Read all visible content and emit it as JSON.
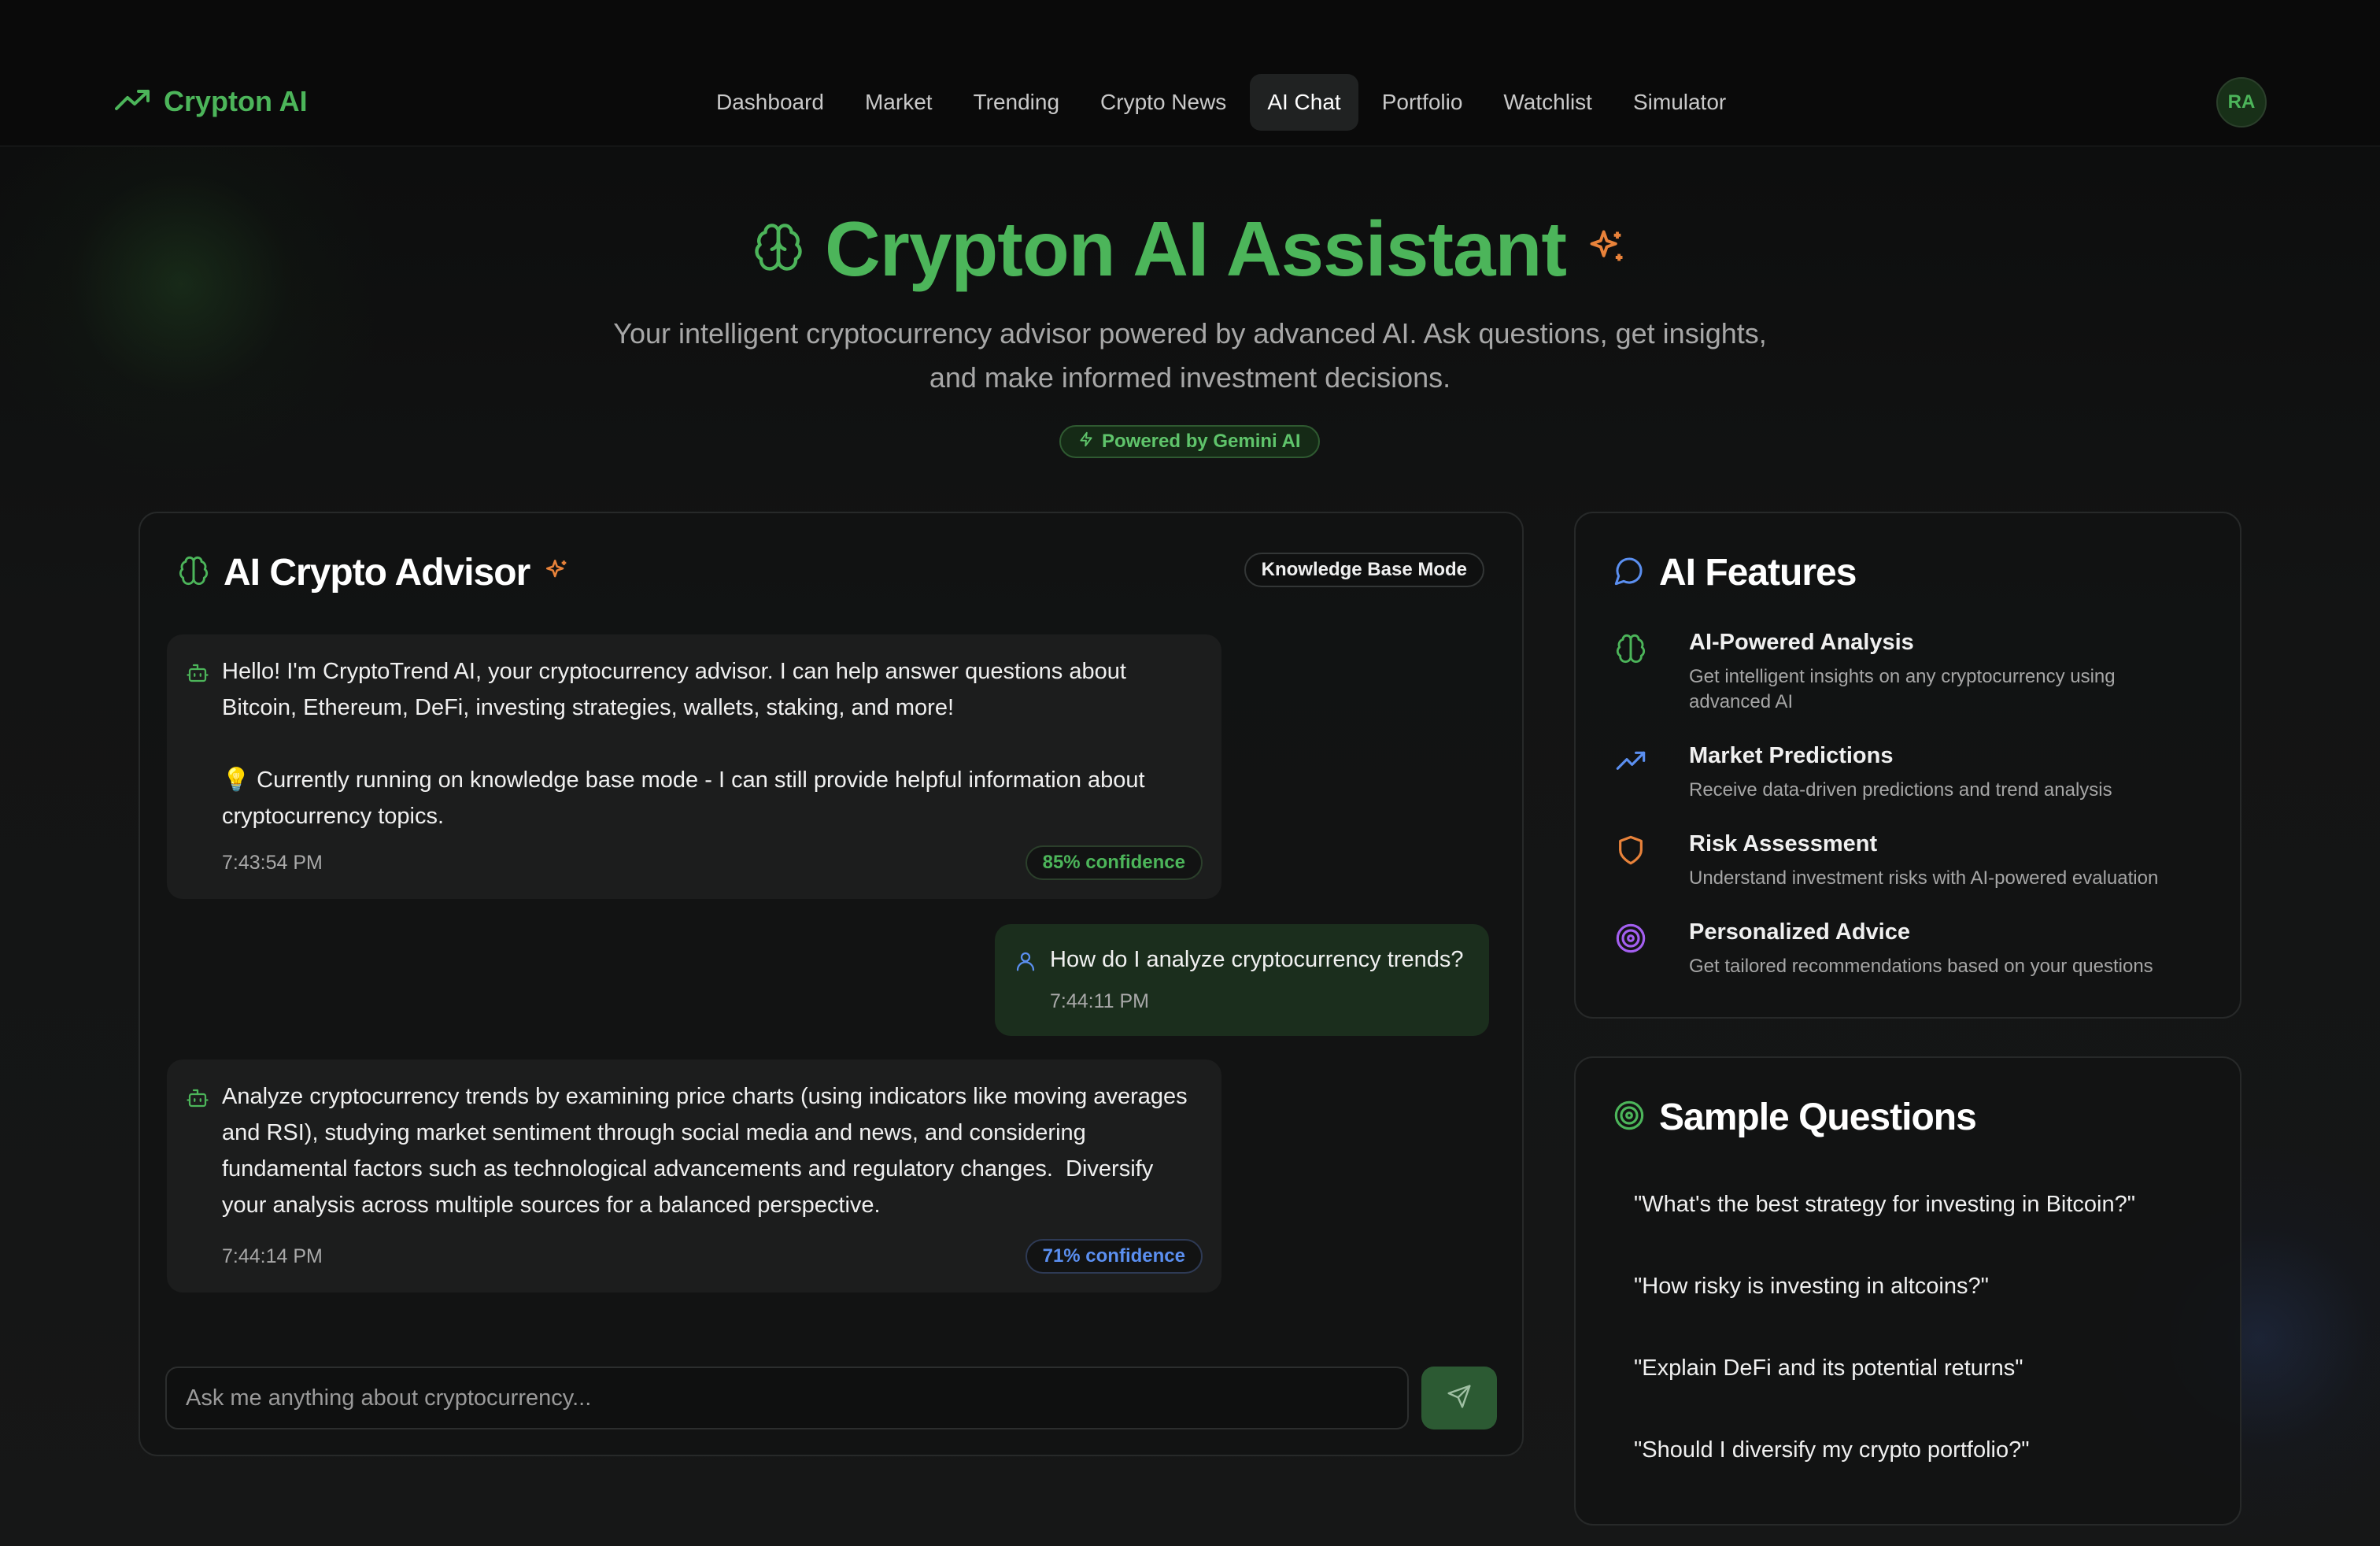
{
  "nav": {
    "brand": "Crypton AI",
    "items": [
      "Dashboard",
      "Market",
      "Trending",
      "Crypto News",
      "AI Chat",
      "Portfolio",
      "Watchlist",
      "Simulator"
    ],
    "active": "AI Chat",
    "avatar": "RA"
  },
  "hero": {
    "title": "Crypton AI Assistant",
    "subtitle_line1": "Your intelligent cryptocurrency advisor powered by advanced AI. Ask questions, get insights,",
    "subtitle_line2": "and make informed investment decisions.",
    "badge": "Powered by Gemini AI"
  },
  "chat": {
    "title": "AI Crypto Advisor",
    "mode_badge": "Knowledge Base Mode",
    "messages": [
      {
        "role": "assistant",
        "text": "Hello! I'm CryptoTrend AI, your cryptocurrency advisor. I can help answer questions about\nBitcoin, Ethereum, DeFi, investing strategies, wallets, staking, and more!\n\n💡 Currently running on knowledge base mode - I can still provide helpful information about\ncryptocurrency topics.",
        "time": "7:43:54 PM",
        "confidence": "85% confidence"
      },
      {
        "role": "user",
        "text": "How do I analyze cryptocurrency trends?",
        "time": "7:44:11 PM"
      },
      {
        "role": "assistant",
        "text": "Analyze cryptocurrency trends by examining price charts (using indicators like moving averages\nand RSI), studying market sentiment through social media and news, and considering\nfundamental factors such as technological advancements and regulatory changes.  Diversify\nyour analysis across multiple sources for a balanced perspective.",
        "time": "7:44:14 PM",
        "confidence": "71% confidence"
      }
    ],
    "input_placeholder": "Ask me anything about cryptocurrency..."
  },
  "features": {
    "title": "AI Features",
    "items": [
      {
        "icon": "brain-icon",
        "title": "AI-Powered Analysis",
        "desc": "Get intelligent insights on any cryptocurrency using advanced AI",
        "color": "#4cb55a"
      },
      {
        "icon": "trending-up-icon",
        "title": "Market Predictions",
        "desc": "Receive data-driven predictions and trend analysis",
        "color": "#5b8ff0"
      },
      {
        "icon": "shield-icon",
        "title": "Risk Assessment",
        "desc": "Understand investment risks with AI-powered evaluation",
        "color": "#e8823a"
      },
      {
        "icon": "target-icon",
        "title": "Personalized Advice",
        "desc": "Get tailored recommendations based on your questions",
        "color": "#a35ff0"
      }
    ]
  },
  "samples": {
    "title": "Sample Questions",
    "items": [
      "\"What's the best strategy for investing in Bitcoin?\"",
      "\"How risky is investing in altcoins?\"",
      "\"Explain DeFi and its potential returns\"",
      "\"Should I diversify my crypto portfolio?\""
    ]
  },
  "colors": {
    "accent": "#4cb55a",
    "blue": "#5b8ff0",
    "orange": "#e8823a",
    "purple": "#a35ff0"
  }
}
